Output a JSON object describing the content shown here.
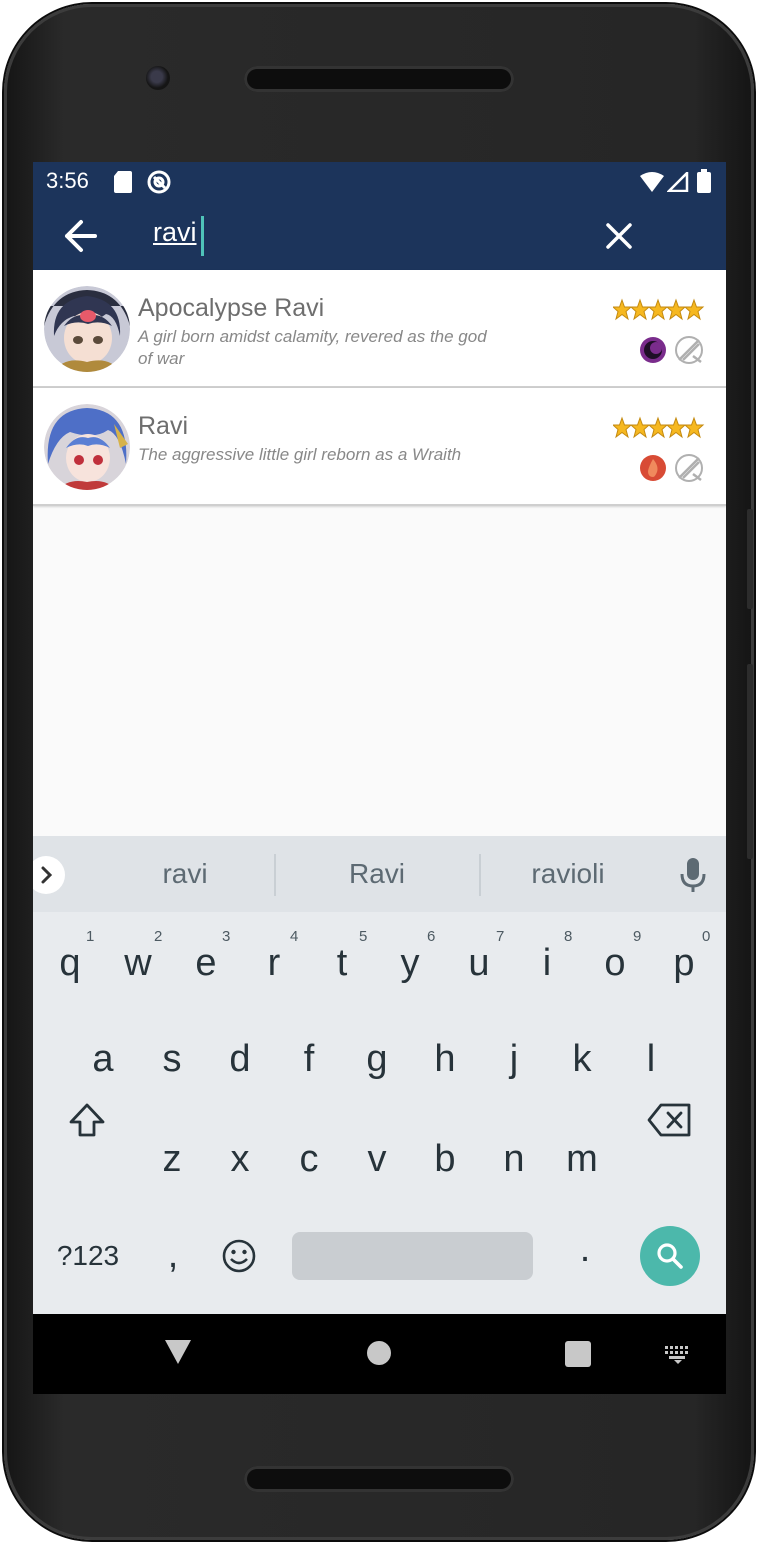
{
  "status_bar": {
    "time": "3:56"
  },
  "search": {
    "query": "ravi"
  },
  "results": [
    {
      "name": "Apocalypse Ravi",
      "description": "A girl born amidst calamity, revered as the god of war",
      "stars": 5,
      "element": "dark-element-icon",
      "role": "warrior-class-icon",
      "element_color": "#7a2c8c"
    },
    {
      "name": "Ravi",
      "description": "The aggressive little girl reborn as a Wraith",
      "stars": 5,
      "element": "fire-element-icon",
      "role": "warrior-class-icon",
      "element_color": "#d84b35"
    }
  ],
  "keyboard": {
    "suggestions": [
      "ravi",
      "Ravi",
      "ravioli"
    ],
    "row1": [
      "q",
      "w",
      "e",
      "r",
      "t",
      "y",
      "u",
      "i",
      "o",
      "p"
    ],
    "row1_hints": [
      "1",
      "2",
      "3",
      "4",
      "5",
      "6",
      "7",
      "8",
      "9",
      "0"
    ],
    "row2": [
      "a",
      "s",
      "d",
      "f",
      "g",
      "h",
      "j",
      "k",
      "l"
    ],
    "row3": [
      "z",
      "x",
      "c",
      "v",
      "b",
      "n",
      "m"
    ],
    "symbols_label": "?123",
    "comma": ",",
    "period": "."
  },
  "colors": {
    "app_bar": "#1c345b",
    "accent": "#4cb8ab",
    "star": "#f6b820"
  }
}
